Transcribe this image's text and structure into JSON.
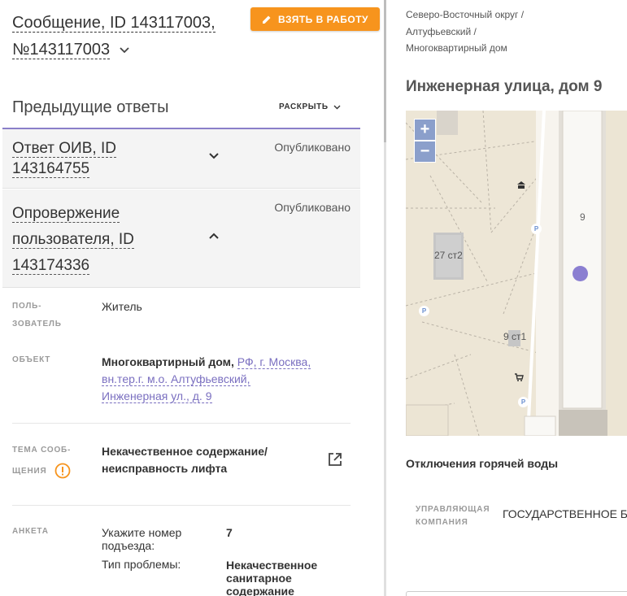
{
  "message": {
    "title": "Сообщение, ID 143117003, №143117003",
    "take_button": "ВЗЯТЬ В РАБОТУ"
  },
  "previous_answers": {
    "title": "Предыдущие ответы",
    "expand_label": "РАСКРЫТЬ",
    "items": [
      {
        "title": "Ответ ОИВ, ID 143164755",
        "status": "Опубликовано",
        "expanded": false
      },
      {
        "title": "Опровержение пользователя, ID 143174336",
        "status": "Опубликовано",
        "expanded": true
      }
    ]
  },
  "details": {
    "user_label": "ПОЛЬ-ЗОВАТЕЛЬ",
    "user_value": "Житель",
    "object_label": "ОБЪЕКТ",
    "object_type": "Многоквартирный дом,",
    "object_link": "РФ, г. Москва, вн.тер.г. м.о. Алтуфьевский, Инженерная ул., д. 9",
    "topic_label": "ТЕМА СООБ-ЩЕНИЯ",
    "topic_value": "Некачественное содержание/ неисправность лифта",
    "form_label": "АНКЕТА",
    "form_rows": [
      {
        "q": "Укажите номер подъезда:",
        "a": "7"
      },
      {
        "q": "Тип проблемы:",
        "a": "Некачественное санитарное содержание"
      }
    ]
  },
  "location": {
    "breadcrumbs": [
      "Северо-Восточный округ /",
      "Алтуфьевский /",
      "Многоквартирный дом"
    ],
    "address": "Инженерная улица, дом 9",
    "map": {
      "zoom_in": "+",
      "zoom_out": "−",
      "labels": [
        "9",
        "27 ст2",
        "9 ст1"
      ],
      "parking_label": "P",
      "marker_color": "#8b7fd1"
    },
    "hot_water": "Отключения горячей воды",
    "management_label": "УПРАВЛЯЮЩАЯ КОМПАНИЯ",
    "management_value": "ГОСУДАРСТВЕННОЕ БЮДЖЕТНОЕ УЧРЕЖДЕНИЕ ГОРОДА МОСКВЫ «ЖИЛИЩНИК АЛТУФЬЕВСКОГО"
  },
  "colors": {
    "accent": "#f7941d",
    "link": "#7a6fc0",
    "warning": "#f7941d"
  }
}
